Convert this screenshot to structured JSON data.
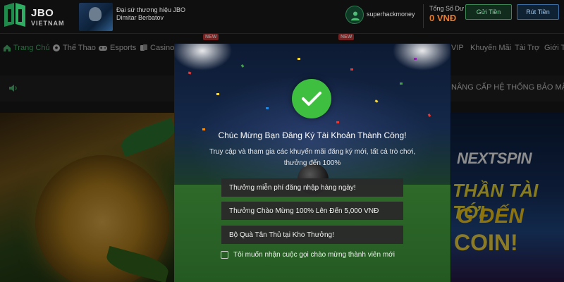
{
  "header": {
    "logo_top": "JBO",
    "logo_bottom": "VIETNAM",
    "ambassador_title": "Đại sứ thương hiệu JBO",
    "ambassador_name": "Dimitar Berbatov",
    "username": "superhackmoney",
    "balance_label": "Tổng Số Dư",
    "balance_value": "0 VNĐ",
    "deposit_label": "Gửi Tiền",
    "withdraw_label": "Rút Tiền"
  },
  "nav": {
    "items": [
      {
        "label": "Trang Chủ",
        "icon": "home-icon",
        "active": true
      },
      {
        "label": "Thể Thao",
        "icon": "soccer-ball-icon"
      },
      {
        "label": "Esports",
        "icon": "gamepad-icon"
      },
      {
        "label": "Casino",
        "icon": "cards-icon"
      },
      {
        "label": "VIP"
      },
      {
        "label": "Khuyến Mãi"
      },
      {
        "label": "Tài Trợ"
      },
      {
        "label": "Giới Th"
      }
    ],
    "new_badge": "NEW"
  },
  "marquee": {
    "text": "NÂNG CẤP HỆ THỐNG BẢO MẬT TÀI"
  },
  "banner_right": {
    "brand": "NEXTSPIN",
    "line1": "THẦN TÀI TỚI",
    "line2": "G ĐẾN",
    "line3": "COIN!"
  },
  "modal": {
    "title": "Chúc Mừng Bạn Đăng Ký Tài Khoản Thành Công!",
    "subtitle_line1": "Truy cập và tham gia các khuyến mãi đăng ký mới, tất cả trò chơi,",
    "subtitle_line2": "thưởng đến 100%",
    "bonuses": [
      "Thưởng miễn phí đăng nhập hàng ngày!",
      "Thưởng Chào Mừng 100% Lên Đến 5,000 VNĐ",
      "Bộ Quà Tân Thủ tại Kho Thưởng!"
    ],
    "optin_label": "Tôi muốn nhận cuộc gọi chào mừng thành viên mới",
    "optin_checked": false
  },
  "colors": {
    "accent_green": "#4fbf77",
    "balance_orange": "#e57b2f",
    "check_green": "#3fbf3f"
  }
}
